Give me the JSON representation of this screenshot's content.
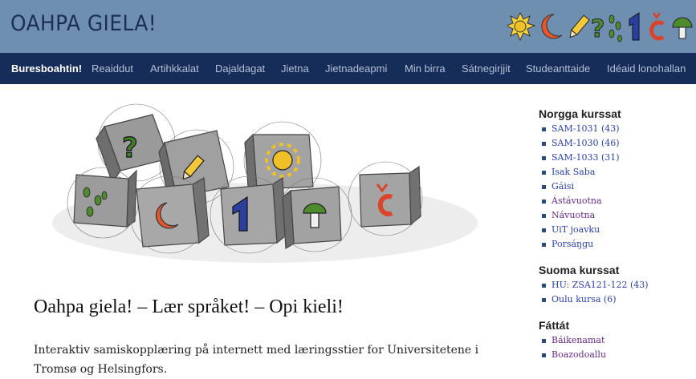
{
  "site": {
    "title": "OAHPA GIELA!"
  },
  "nav": {
    "items": [
      {
        "label": "Buresboahtin!",
        "active": true
      },
      {
        "label": "Reaiddut"
      },
      {
        "label": "Artihkkalat"
      },
      {
        "label": "Dajaldagat"
      },
      {
        "label": "Jietna"
      },
      {
        "label": "Jietnadeapmi"
      },
      {
        "label": "Min birra"
      },
      {
        "label": "Sátnegirjjit"
      },
      {
        "label": "Studeanttaide"
      },
      {
        "label": "Idéaid lonohallan"
      }
    ]
  },
  "main": {
    "heading": "Oahpa giela! – Lær språket! – Opi kieli!",
    "intro_line1": "Interaktiv samiskopplæring på internett med læringsstier for Universitetene i",
    "intro_line2": "Tromsø og Helsingfors."
  },
  "sidebar": {
    "sections": [
      {
        "heading": "Norgga kurssat",
        "items": [
          {
            "label": "SAM-1031 (43)"
          },
          {
            "label": "SAM-1030 (46)"
          },
          {
            "label": "SAM-1033 (31)"
          },
          {
            "label": "Isak Saba"
          },
          {
            "label": "Gáisi"
          },
          {
            "label": "Ástávuotna",
            "visited": true
          },
          {
            "label": "Návuotna",
            "visited": true
          },
          {
            "label": "UiT joavku"
          },
          {
            "label": "Porsáŋgu"
          }
        ]
      },
      {
        "heading": "Suoma kurssat",
        "items": [
          {
            "label": "HU: ZSA121-122 (43)"
          },
          {
            "label": "Oulu kursa (6)"
          }
        ]
      },
      {
        "heading": "Fáttát",
        "items": [
          {
            "label": "Báikenamat",
            "visited": true
          },
          {
            "label": "Boazodoallu",
            "visited": true
          }
        ]
      }
    ]
  },
  "colors": {
    "header_bg": "#6f8fb0",
    "nav_bg": "#162c59",
    "title_color": "#1b2f55",
    "link": "#2a3fb0",
    "visited_link": "#6a2a8c"
  },
  "icons": [
    "sun-icon",
    "moon-icon",
    "pencil-icon",
    "question-icon",
    "footprints-icon",
    "number-one-icon",
    "c-caron-icon",
    "mushroom-icon"
  ]
}
